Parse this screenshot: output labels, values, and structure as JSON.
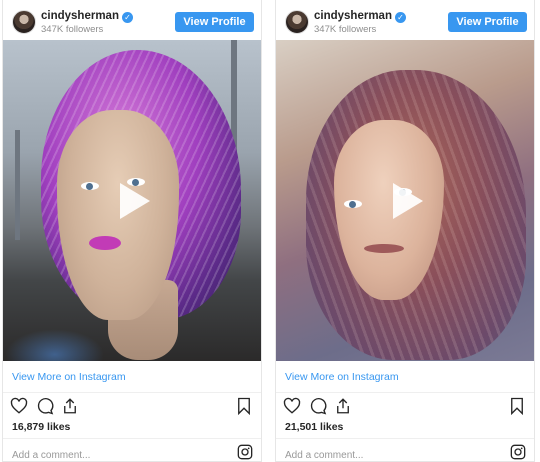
{
  "colors": {
    "accent": "#3897f0",
    "text": "#262626",
    "muted": "#8e8e8e"
  },
  "posts": [
    {
      "username": "cindysherman",
      "followers": "347K followers",
      "view_profile_label": "View Profile",
      "view_more_label": "View More on Instagram",
      "likes": "16,879 likes",
      "comment_placeholder": "Add a comment..."
    },
    {
      "username": "cindysherman",
      "followers": "347K followers",
      "view_profile_label": "View Profile",
      "view_more_label": "View More on Instagram",
      "likes": "21,501 likes",
      "comment_placeholder": "Add a comment..."
    }
  ],
  "icons": [
    "verified-badge-icon",
    "play-icon",
    "heart-icon",
    "comment-icon",
    "share-icon",
    "bookmark-icon",
    "instagram-icon"
  ]
}
